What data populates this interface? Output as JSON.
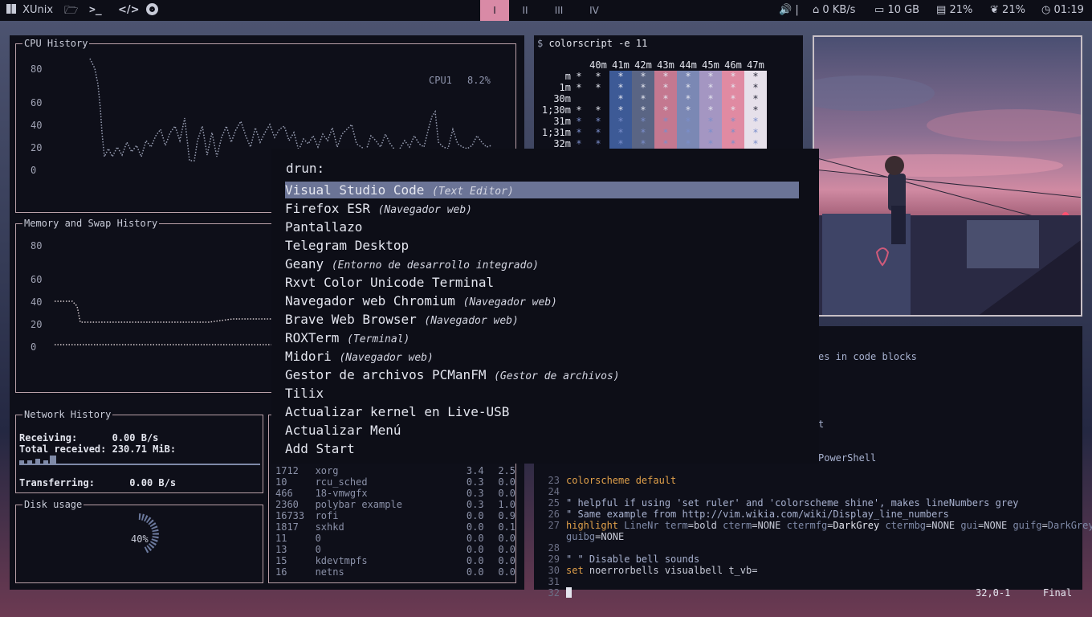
{
  "topbar": {
    "brand": "XUnix",
    "workspaces": [
      "I",
      "II",
      "III",
      "IV"
    ],
    "active_workspace": "I",
    "volume_sep": "|",
    "net": "0 KB/s",
    "disk": "10 GB",
    "mem": "21%",
    "cpu": "21%",
    "clock": "01:19"
  },
  "conky": {
    "cpu_title": "CPU History",
    "cpu_label": "CPU1",
    "cpu_value": "8.2%",
    "cpu_ticks": [
      "80",
      "60",
      "40",
      "20",
      "0"
    ],
    "mem_title": "Memory and Swap History",
    "mem_ticks": [
      "80",
      "60",
      "40",
      "20",
      "0"
    ],
    "net_title": "Network History",
    "receiving_label": "Receiving:",
    "receiving_value": "0.00 B/s",
    "total_label": "Total received:",
    "total_value": "230.71 MiB:",
    "transfer_label": "Transferring:",
    "transfer_value": "0.00 B/s",
    "disk_title": "Disk usage",
    "disk_value": "40%"
  },
  "processes": [
    {
      "pid": "1712",
      "name": "xorg",
      "cpu": "3.4",
      "mem": "2.5"
    },
    {
      "pid": "10",
      "name": "rcu_sched",
      "cpu": "0.3",
      "mem": "0.0"
    },
    {
      "pid": "466",
      "name": "18-vmwgfx",
      "cpu": "0.3",
      "mem": "0.0"
    },
    {
      "pid": "2360",
      "name": "polybar example",
      "cpu": "0.3",
      "mem": "1.0"
    },
    {
      "pid": "16733",
      "name": "rofi",
      "cpu": "0.0",
      "mem": "0.9"
    },
    {
      "pid": "1817",
      "name": "sxhkd",
      "cpu": "0.0",
      "mem": "0.1"
    },
    {
      "pid": "11",
      "name": "0",
      "cpu": "0.0",
      "mem": "0.0"
    },
    {
      "pid": "13",
      "name": "0",
      "cpu": "0.0",
      "mem": "0.0"
    },
    {
      "pid": "15",
      "name": "kdevtmpfs",
      "cpu": "0.0",
      "mem": "0.0"
    },
    {
      "pid": "16",
      "name": "netns",
      "cpu": "0.0",
      "mem": "0.0"
    }
  ],
  "colorscript": {
    "prompt": "$",
    "command": "colorscript -e 11",
    "col_headers": [
      "",
      "",
      "40m",
      "41m",
      "42m",
      "43m",
      "44m",
      "45m",
      "46m",
      "47m"
    ],
    "row_labels": [
      "m",
      "1m",
      "30m",
      "1;30m",
      "31m",
      "1;31m",
      "32m"
    ]
  },
  "rofi": {
    "prompt": "drun:",
    "items": [
      {
        "name": "Visual Studio Code",
        "desc": "(Text Editor)"
      },
      {
        "name": "Firefox ESR",
        "desc": "(Navegador web)"
      },
      {
        "name": "Pantallazo",
        "desc": ""
      },
      {
        "name": "Telegram Desktop",
        "desc": ""
      },
      {
        "name": "Geany",
        "desc": "(Entorno de desarrollo integrado)"
      },
      {
        "name": "Rxvt Color Unicode Terminal",
        "desc": ""
      },
      {
        "name": "Navegador web Chromium",
        "desc": "(Navegador web)"
      },
      {
        "name": "Brave Web Browser",
        "desc": "(Navegador web)"
      },
      {
        "name": "ROXTerm",
        "desc": "(Terminal)"
      },
      {
        "name": "Midori",
        "desc": "(Navegador web)"
      },
      {
        "name": "Gestor de archivos PCManFM",
        "desc": "(Gestor de archivos)"
      },
      {
        "name": "Tilix",
        "desc": ""
      },
      {
        "name": "Actualizar kernel en Live-USB",
        "desc": ""
      },
      {
        "name": "Actualizar Menú",
        "desc": ""
      },
      {
        "name": "Add Start",
        "desc": ""
      }
    ]
  },
  "vim": {
    "frag1": "es in code blocks",
    "frag2": "t",
    "frag3": "PowerShell",
    "l23": "colorscheme default",
    "l25": "\" helpful if using 'set ruler' and 'colorscheme shine', makes lineNumbers grey",
    "l26": "\" Same example from http://vim.wikia.com/wiki/Display_line_numbers",
    "l29": "\" \" Disable bell sounds",
    "l30": "noerrorbells visualbell t_vb=",
    "ruler": "32,0-1",
    "position": "Final"
  }
}
